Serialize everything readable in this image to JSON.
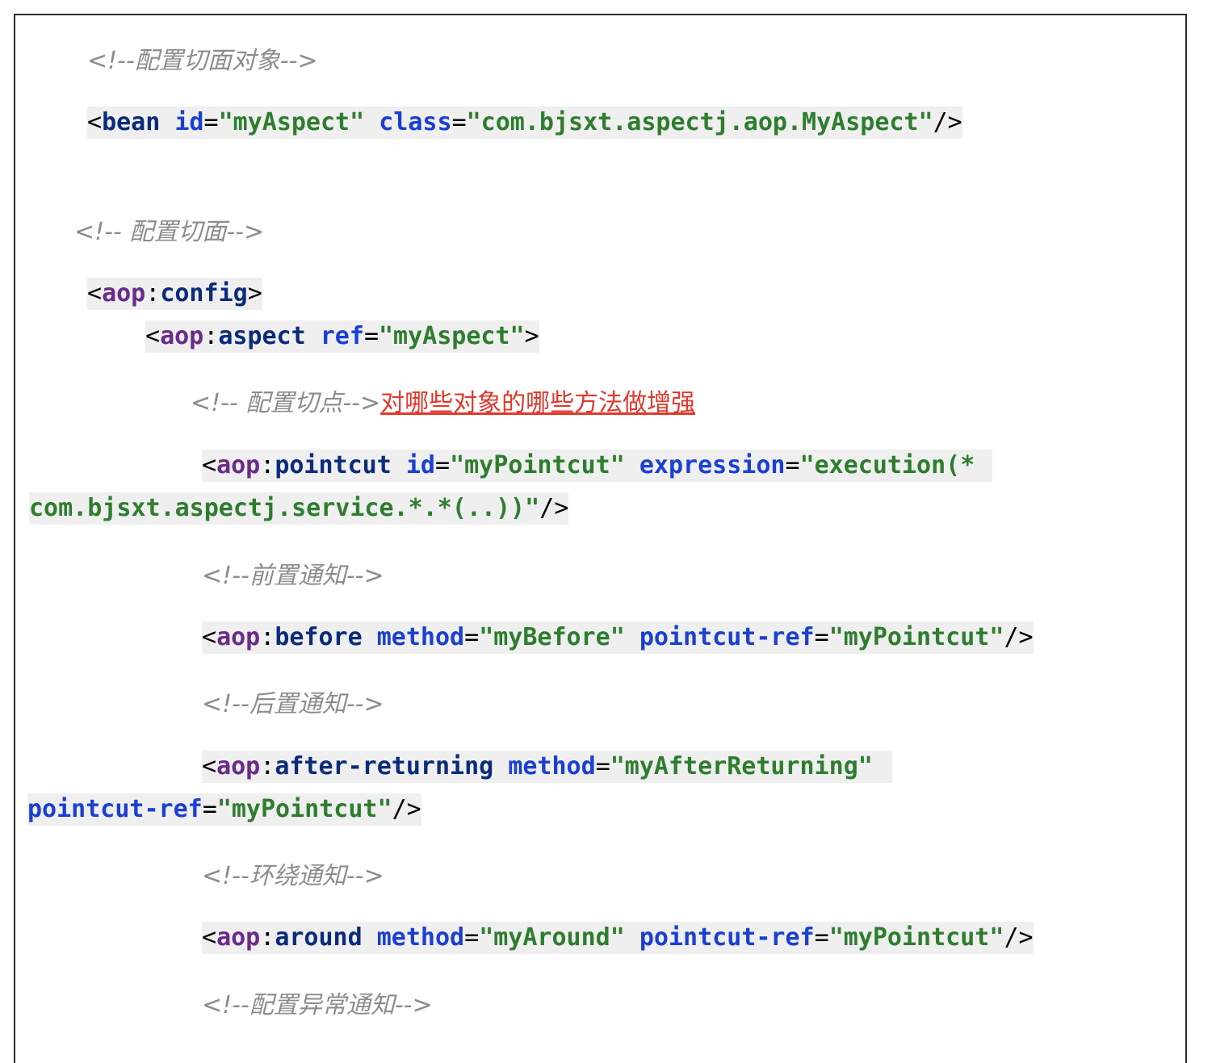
{
  "comments": {
    "aspect_object": "<!--配置切面对象-->",
    "aspect": "<!-- 配置切面-->",
    "pointcut": "<!-- 配置切点-->",
    "before": "<!--前置通知-->",
    "after_returning": "<!--后置通知-->",
    "around": "<!--环绕通知-->",
    "throwing": "<!--配置异常通知-->"
  },
  "pointcut_note": "对哪些对象的哪些方法做增强",
  "bean": {
    "tag": "bean",
    "id_attr": "id",
    "id_val": "\"myAspect\"",
    "class_attr": "class",
    "class_val": "\"com.bjsxt.aspectj.aop.MyAspect\""
  },
  "config": {
    "ns": "aop",
    "tag": "config"
  },
  "aspect": {
    "ns": "aop",
    "tag": "aspect",
    "ref_attr": "ref",
    "ref_val": "\"myAspect\""
  },
  "pointcut": {
    "ns": "aop",
    "tag": "pointcut",
    "id_attr": "id",
    "id_val": "\"myPointcut\"",
    "expr_attr": "expression",
    "expr_val_1": "\"execution(*",
    "expr_val_2": "com.bjsxt.aspectj.service.*.*(..))\""
  },
  "before": {
    "ns": "aop",
    "tag": "before",
    "method_attr": "method",
    "method_val": "\"myBefore\"",
    "ref_attr": "pointcut-ref",
    "ref_val": "\"myPointcut\""
  },
  "after_returning": {
    "ns": "aop",
    "tag": "after-returning",
    "method_attr": "method",
    "method_val": "\"myAfterReturning\"",
    "ref_attr": "pointcut-ref",
    "ref_val": "\"myPointcut\""
  },
  "around": {
    "ns": "aop",
    "tag": "around",
    "method_attr": "method",
    "method_val": "\"myAround\"",
    "ref_attr": "pointcut-ref",
    "ref_val": "\"myPointcut\""
  },
  "colors": {
    "comment": "#8c8c8c",
    "namespace": "#6a2b8a",
    "tag": "#0b2b7a",
    "attribute": "#1a3fd1",
    "value": "#2e7d2e",
    "note": "#e0382b",
    "highlight": "#efefef"
  }
}
